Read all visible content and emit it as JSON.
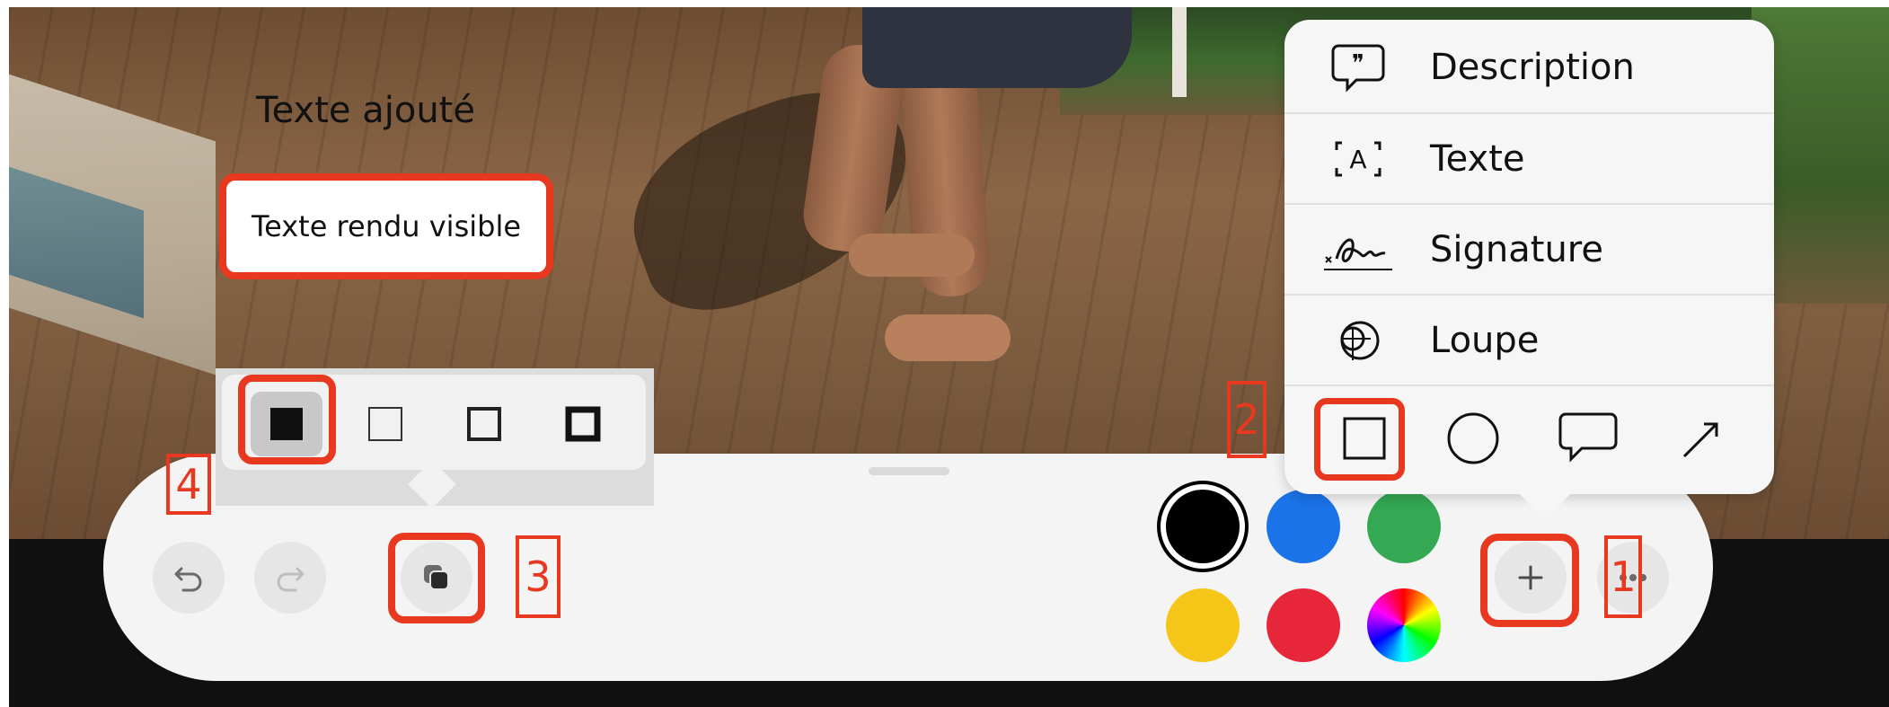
{
  "canvas": {
    "added_text": "Texte ajouté",
    "textbox_text": "Texte rendu visible"
  },
  "callouts": {
    "n1": "1",
    "n2": "2",
    "n3": "3",
    "n4": "4"
  },
  "insert_menu": {
    "items": [
      {
        "label": "Description",
        "icon": "speech-bubble-quote-icon"
      },
      {
        "label": "Texte",
        "icon": "text-box-icon"
      },
      {
        "label": "Signature",
        "icon": "signature-icon"
      },
      {
        "label": "Loupe",
        "icon": "magnifier-icon"
      }
    ],
    "shapes": [
      "square-shape-icon",
      "circle-shape-icon",
      "speech-bubble-shape-icon",
      "arrow-shape-icon"
    ]
  },
  "shape_style_popup": {
    "options": [
      "filled-square-icon",
      "thin-outline-square-icon",
      "medium-outline-square-icon",
      "thick-outline-square-icon"
    ],
    "selected": 0
  },
  "toolbar": {
    "colors": [
      "#000000",
      "#1a73e8",
      "#34a853",
      "#f5c518",
      "#e8263a",
      "color-wheel"
    ],
    "selected_color": "#000000"
  },
  "accent": "#e8381f"
}
